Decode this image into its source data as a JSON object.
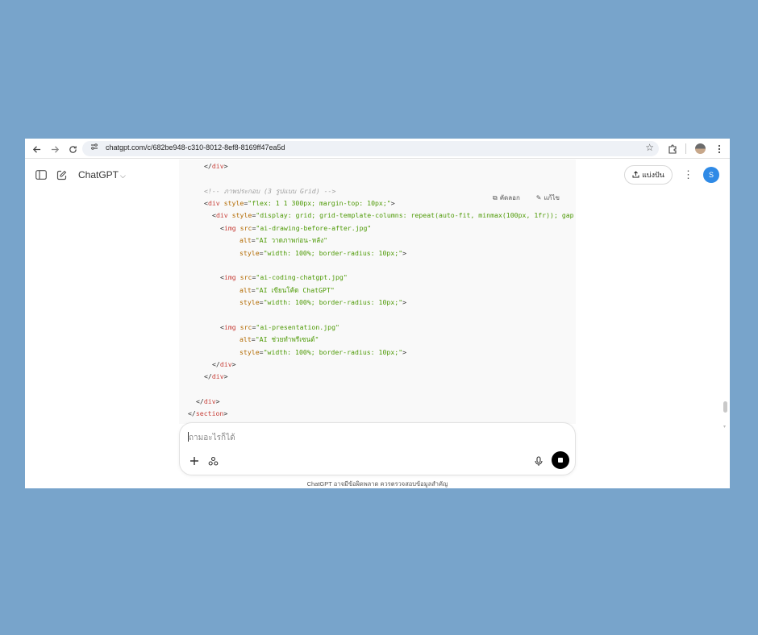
{
  "browser": {
    "url": "chatgpt.com/c/682be948-c310-8012-8ef8-8169ff47ea5d",
    "icons": [
      "back-icon",
      "forward-icon",
      "reload-icon",
      "site-info-icon",
      "star-icon",
      "extensions-icon",
      "profile-icon",
      "menu-icon"
    ]
  },
  "header": {
    "model_name": "ChatGPT",
    "share_label": "แบ่งปัน",
    "avatar_initial": "S"
  },
  "code_block": {
    "copy_label": "คัดลอก",
    "edit_label": "แก้ไข",
    "lines": [
      "</div>",
      "",
      "<!-- ภาพประกอบ (3 รูปแบบ Grid) -->",
      "<div style=\"flex: 1 1 300px; margin-top: 10px;\">",
      "<div style=\"display: grid; grid-template-columns: repeat(auto-fit, minmax(100px, 1fr)); gap",
      "<img src=\"ai-drawing-before-after.jpg\"",
      "alt=\"AI วาดภาพก่อน-หลัง\"",
      "style=\"width: 100%; border-radius: 10px;\">",
      "",
      "<img src=\"ai-coding-chatgpt.jpg\"",
      "alt=\"AI เขียนโค้ด ChatGPT\"",
      "style=\"width: 100%; border-radius: 10px;\">",
      "",
      "<img src=\"ai-presentation.jpg\"",
      "alt=\"AI ช่วยทำพรีเซนต์\"",
      "style=\"width: 100%; border-radius: 10px;\">",
      "</div>",
      "</div>",
      "",
      "</div>",
      "</section>"
    ]
  },
  "composer": {
    "placeholder": "ถามอะไรก็ได้"
  },
  "footer": {
    "disclaimer": "ChatGPT อาจมีข้อผิดพลาด ควรตรวจสอบข้อมูลสำคัญ"
  }
}
